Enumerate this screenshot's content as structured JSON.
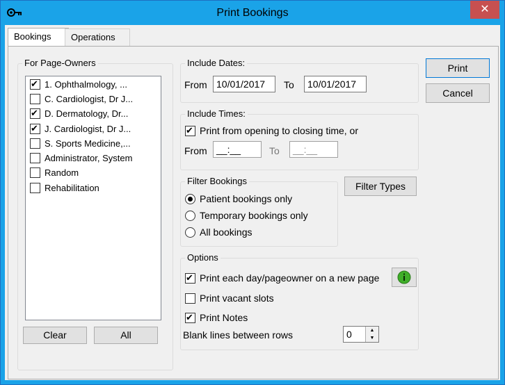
{
  "window": {
    "title": "Print Bookings",
    "close_glyph": "✕"
  },
  "tabs": [
    {
      "label": "Bookings",
      "selected": true
    },
    {
      "label": "Operations",
      "selected": false
    }
  ],
  "page_owners": {
    "legend": "For Page-Owners",
    "items": [
      {
        "label": "1. Ophthalmology, ...",
        "checked": true
      },
      {
        "label": "C. Cardiologist, Dr J...",
        "checked": false
      },
      {
        "label": "D. Dermatology, Dr...",
        "checked": true
      },
      {
        "label": "J. Cardiologist, Dr J...",
        "checked": true
      },
      {
        "label": "S. Sports Medicine,...",
        "checked": false
      },
      {
        "label": "Administrator, System",
        "checked": false
      },
      {
        "label": "Random",
        "checked": false
      },
      {
        "label": "Rehabilitation",
        "checked": false
      }
    ],
    "clear_label": "Clear",
    "all_label": "All"
  },
  "dates": {
    "legend": "Include Dates:",
    "from_label": "From",
    "from_value": "10/01/2017",
    "to_label": "To",
    "to_value": "10/01/2017"
  },
  "times": {
    "legend": "Include Times:",
    "opening_label": "Print from opening to closing time, or",
    "opening_checked": true,
    "from_label": "From",
    "from_value": "__:__",
    "to_label": "To",
    "to_value": "__:__"
  },
  "filter": {
    "legend": "Filter Bookings",
    "options": [
      {
        "label": "Patient bookings only",
        "selected": true
      },
      {
        "label": "Temporary bookings only",
        "selected": false
      },
      {
        "label": "All bookings",
        "selected": false
      }
    ],
    "types_button": "Filter Types"
  },
  "options": {
    "legend": "Options",
    "each_day_label": "Print each day/pageowner on a new page",
    "each_day_checked": true,
    "vacant_label": "Print vacant slots",
    "vacant_checked": false,
    "notes_label": "Print Notes",
    "notes_checked": true,
    "blank_lines_label": "Blank lines between rows",
    "blank_lines_value": "0",
    "info_icon": "info-icon"
  },
  "actions": {
    "print_label": "Print",
    "cancel_label": "Cancel"
  },
  "colors": {
    "titlebar": "#1aa3e8",
    "close": "#c75050",
    "info_green": "#3fae29"
  }
}
